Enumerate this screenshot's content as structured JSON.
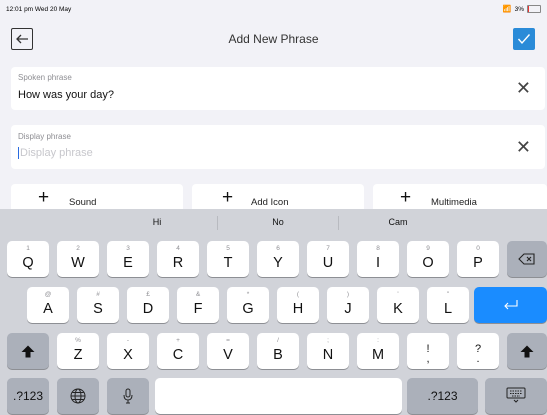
{
  "status_bar": {
    "time": "12:01 pm  Wed 20 May",
    "battery": "3%"
  },
  "nav": {
    "title": "Add New Phrase"
  },
  "spoken_field": {
    "label": "Spoken phrase",
    "value": "How was your day?"
  },
  "display_field": {
    "label": "Display phrase",
    "placeholder": "Display phrase"
  },
  "chips": {
    "sound": "Sound",
    "add_icon": "Add Icon",
    "multimedia": "Multimedia"
  },
  "suggestions": [
    "Hi",
    "No",
    "Cam"
  ],
  "keyboard": {
    "row1": [
      {
        "hint": "1",
        "key": "Q"
      },
      {
        "hint": "2",
        "key": "W"
      },
      {
        "hint": "3",
        "key": "E"
      },
      {
        "hint": "4",
        "key": "R"
      },
      {
        "hint": "5",
        "key": "T"
      },
      {
        "hint": "6",
        "key": "Y"
      },
      {
        "hint": "7",
        "key": "U"
      },
      {
        "hint": "8",
        "key": "I"
      },
      {
        "hint": "9",
        "key": "O"
      },
      {
        "hint": "0",
        "key": "P"
      }
    ],
    "row2": [
      {
        "hint": "@",
        "key": "A"
      },
      {
        "hint": "#",
        "key": "S"
      },
      {
        "hint": "£",
        "key": "D"
      },
      {
        "hint": "&",
        "key": "F"
      },
      {
        "hint": "*",
        "key": "G"
      },
      {
        "hint": "(",
        "key": "H"
      },
      {
        "hint": ")",
        "key": "J"
      },
      {
        "hint": "'",
        "key": "K"
      },
      {
        "hint": "\"",
        "key": "L"
      }
    ],
    "row3": [
      {
        "hint": "%",
        "key": "Z"
      },
      {
        "hint": "-",
        "key": "X"
      },
      {
        "hint": "+",
        "key": "C"
      },
      {
        "hint": "=",
        "key": "V"
      },
      {
        "hint": "/",
        "key": "B"
      },
      {
        "hint": ";",
        "key": "N"
      },
      {
        "hint": ":",
        "key": "M"
      },
      {
        "hint": "",
        "key": "!\n,"
      },
      {
        "hint": "",
        "key": "?\n."
      }
    ],
    "numbers_label": ".?123"
  },
  "colors": {
    "accent": "#2a8bd8",
    "return_key": "#1a8cff"
  }
}
